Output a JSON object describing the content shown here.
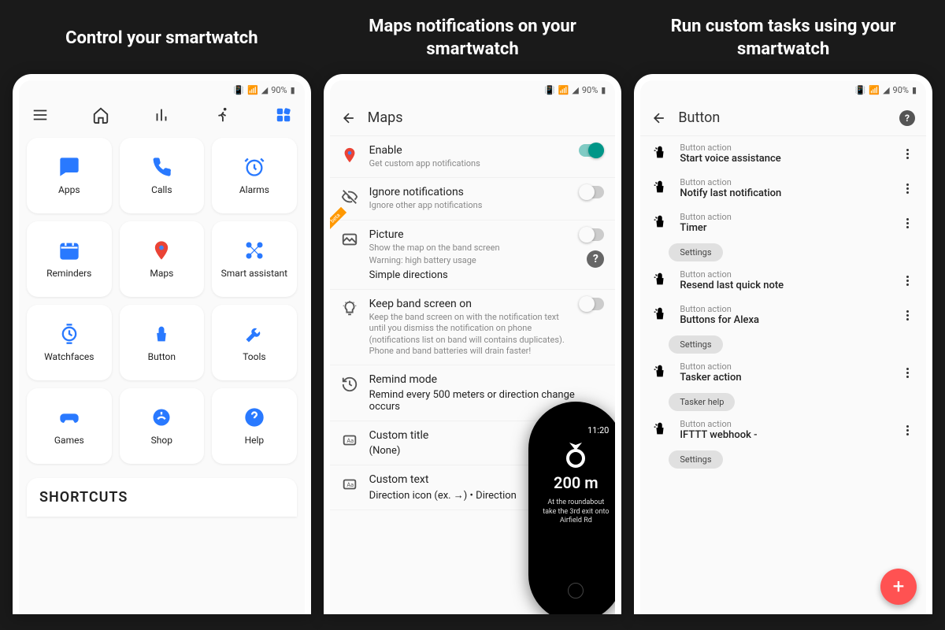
{
  "panels": {
    "p1": {
      "title": "Control your smartwatch"
    },
    "p2": {
      "title": "Maps notifications on your smartwatch"
    },
    "p3": {
      "title": "Run custom tasks using your smartwatch"
    }
  },
  "statusbar": {
    "battery": "90%"
  },
  "screen1": {
    "tiles": [
      {
        "label": "Apps"
      },
      {
        "label": "Calls"
      },
      {
        "label": "Alarms"
      },
      {
        "label": "Reminders"
      },
      {
        "label": "Maps"
      },
      {
        "label": "Smart assistant"
      },
      {
        "label": "Watchfaces"
      },
      {
        "label": "Button"
      },
      {
        "label": "Tools"
      },
      {
        "label": "Games"
      },
      {
        "label": "Shop"
      },
      {
        "label": "Help"
      }
    ],
    "shortcuts": "SHORTCUTS"
  },
  "screen2": {
    "title": "Maps",
    "settings": {
      "enable": {
        "title": "Enable",
        "sub": "Get custom app notifications"
      },
      "ignore": {
        "title": "Ignore notifications",
        "sub": "Ignore other app notifications"
      },
      "picture": {
        "title": "Picture",
        "sub": "Show the map on the band screen",
        "warn": "Warning: high battery usage",
        "extra": "Simple directions"
      },
      "keep": {
        "title": "Keep band screen on",
        "sub": "Keep the band screen on with the notification text until you dismiss the notification on phone (notifications list on band will contains duplicates). Phone and band batteries will drain faster!"
      },
      "remind": {
        "title": "Remind mode",
        "extra": "Remind every 500 meters or direction change occurs"
      },
      "customtitle": {
        "title": "Custom title",
        "extra": "(None)"
      },
      "customtext": {
        "title": "Custom text",
        "extra": "Direction icon (ex. →) • Direction"
      }
    },
    "band": {
      "time": "11:20",
      "distance": "200 m",
      "text": "At the roundabout take the 3rd exit onto Airfield Rd"
    }
  },
  "screen3": {
    "title": "Button",
    "label": "Button action",
    "actions": [
      {
        "title": "Start voice assistance"
      },
      {
        "title": "Notify last notification"
      },
      {
        "title": "Timer",
        "chip": "Settings"
      },
      {
        "title": "Resend last quick note"
      },
      {
        "title": "Buttons for Alexa",
        "chip": "Settings"
      },
      {
        "title": "Tasker action",
        "chip": "Tasker help"
      },
      {
        "title": "IFTTT webhook -",
        "chip": "Settings"
      }
    ]
  }
}
